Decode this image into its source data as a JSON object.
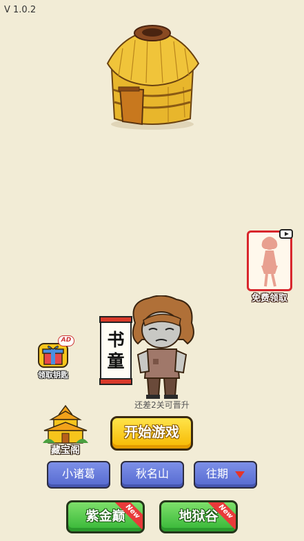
{
  "version": "V 1.0.2",
  "free_claim": {
    "label": "免费领取"
  },
  "rank": {
    "title": "书童",
    "chars": [
      "书",
      "童"
    ]
  },
  "progress_hint": "还差2关可晋升",
  "key_gift": {
    "badge": "AD",
    "label": "领取钥匙"
  },
  "treasure": {
    "label": "藏宝阁"
  },
  "start_button": {
    "label": "开始游戏"
  },
  "mode_buttons": [
    {
      "label": "小诸葛"
    },
    {
      "label": "秋名山"
    },
    {
      "label": "往期"
    }
  ],
  "level_buttons": [
    {
      "label": "紫金巅",
      "badge": "New"
    },
    {
      "label": "地狱谷",
      "badge": "New"
    }
  ],
  "colors": {
    "background": "#f2ecd6",
    "start_yellow": "#f6b800",
    "blue_button": "#5569cf",
    "green_button": "#35b536",
    "new_red": "#e83a3a"
  }
}
